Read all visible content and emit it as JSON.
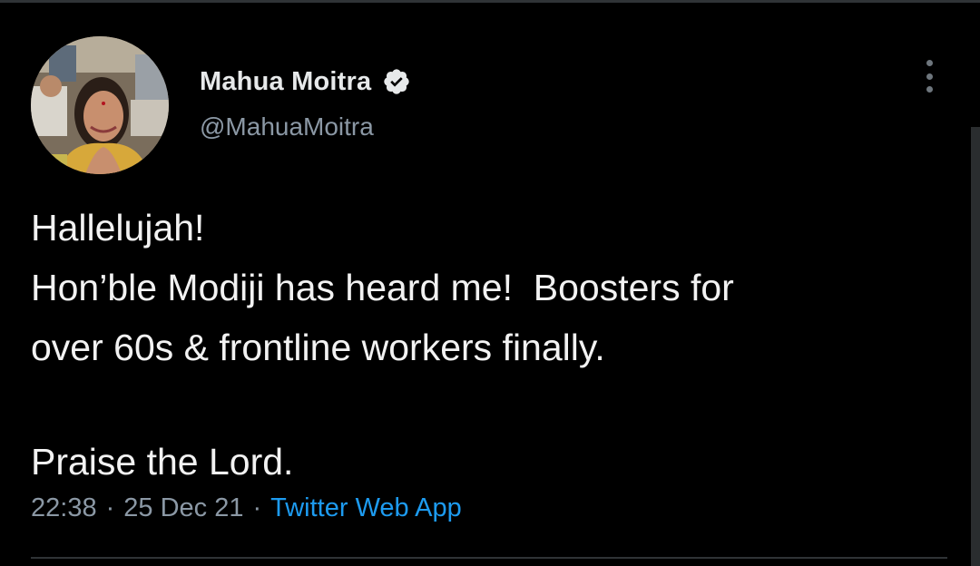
{
  "tweet": {
    "author": {
      "display_name": "Mahua Moitra",
      "handle": "@MahuaMoitra",
      "verified": true,
      "verified_icon": "verified-badge-icon"
    },
    "lines": [
      "Hallelujah!",
      "Hon’ble Modiji has heard me!  Boosters for",
      "over 60s & frontline workers finally.",
      "Praise the Lord."
    ],
    "time": "22:38",
    "separator": "·",
    "date": "25 Dec 21",
    "source": "Twitter Web App"
  },
  "menu": {
    "icon": "more-vertical-icon"
  },
  "colors": {
    "background": "#000000",
    "text": "#e7e9ea",
    "secondary": "#8b98a5",
    "link": "#1d9bf0",
    "divider": "#2f3336"
  }
}
